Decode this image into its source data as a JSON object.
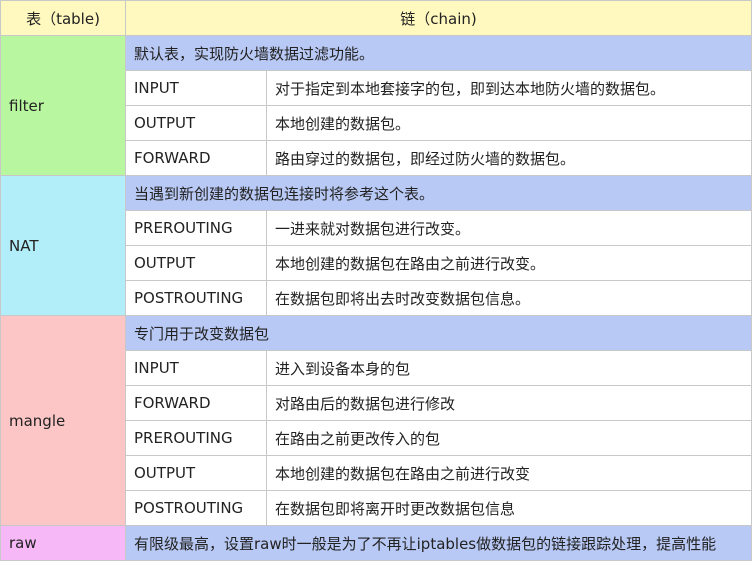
{
  "header": {
    "table_col": "表（table)",
    "chain_col": "链（chain)"
  },
  "tables": [
    {
      "name": "filter",
      "description": "默认表，实现防火墙数据过滤功能。",
      "chains": [
        {
          "chain": "INPUT",
          "desc": "对于指定到本地套接字的包，即到达本地防火墙的数据包。"
        },
        {
          "chain": "OUTPUT",
          "desc": "本地创建的数据包。"
        },
        {
          "chain": "FORWARD",
          "desc": "路由穿过的数据包，即经过防火墙的数据包。"
        }
      ]
    },
    {
      "name": "NAT",
      "description": "当遇到新创建的数据包连接时将参考这个表。",
      "chains": [
        {
          "chain": "PREROUTING",
          "desc": "一进来就对数据包进行改变。"
        },
        {
          "chain": "OUTPUT",
          "desc": "本地创建的数据包在路由之前进行改变。"
        },
        {
          "chain": "POSTROUTING",
          "desc": "在数据包即将出去时改变数据包信息。"
        }
      ]
    },
    {
      "name": "mangle",
      "description": "专门用于改变数据包",
      "chains": [
        {
          "chain": "INPUT",
          "desc": "进入到设备本身的包"
        },
        {
          "chain": "FORWARD",
          "desc": "对路由后的数据包进行修改"
        },
        {
          "chain": "PREROUTING",
          "desc": "在路由之前更改传入的包"
        },
        {
          "chain": "OUTPUT",
          "desc": "本地创建的数据包在路由之前进行改变"
        },
        {
          "chain": "POSTROUTING",
          "desc": "在数据包即将离开时更改数据包信息"
        }
      ]
    },
    {
      "name": "raw",
      "description": "有限级最高，设置raw时一般是为了不再让iptables做数据包的链接跟踪处理，提高性能",
      "chains": []
    }
  ],
  "colors": {
    "header_bg": "#fff9bf",
    "desc_bg": "#b9c9f5",
    "filter_bg": "#b8f7a0",
    "nat_bg": "#b2eef9",
    "mangle_bg": "#fcc6c6",
    "raw_bg": "#f7b8f7",
    "border": "#c8c8c8"
  }
}
